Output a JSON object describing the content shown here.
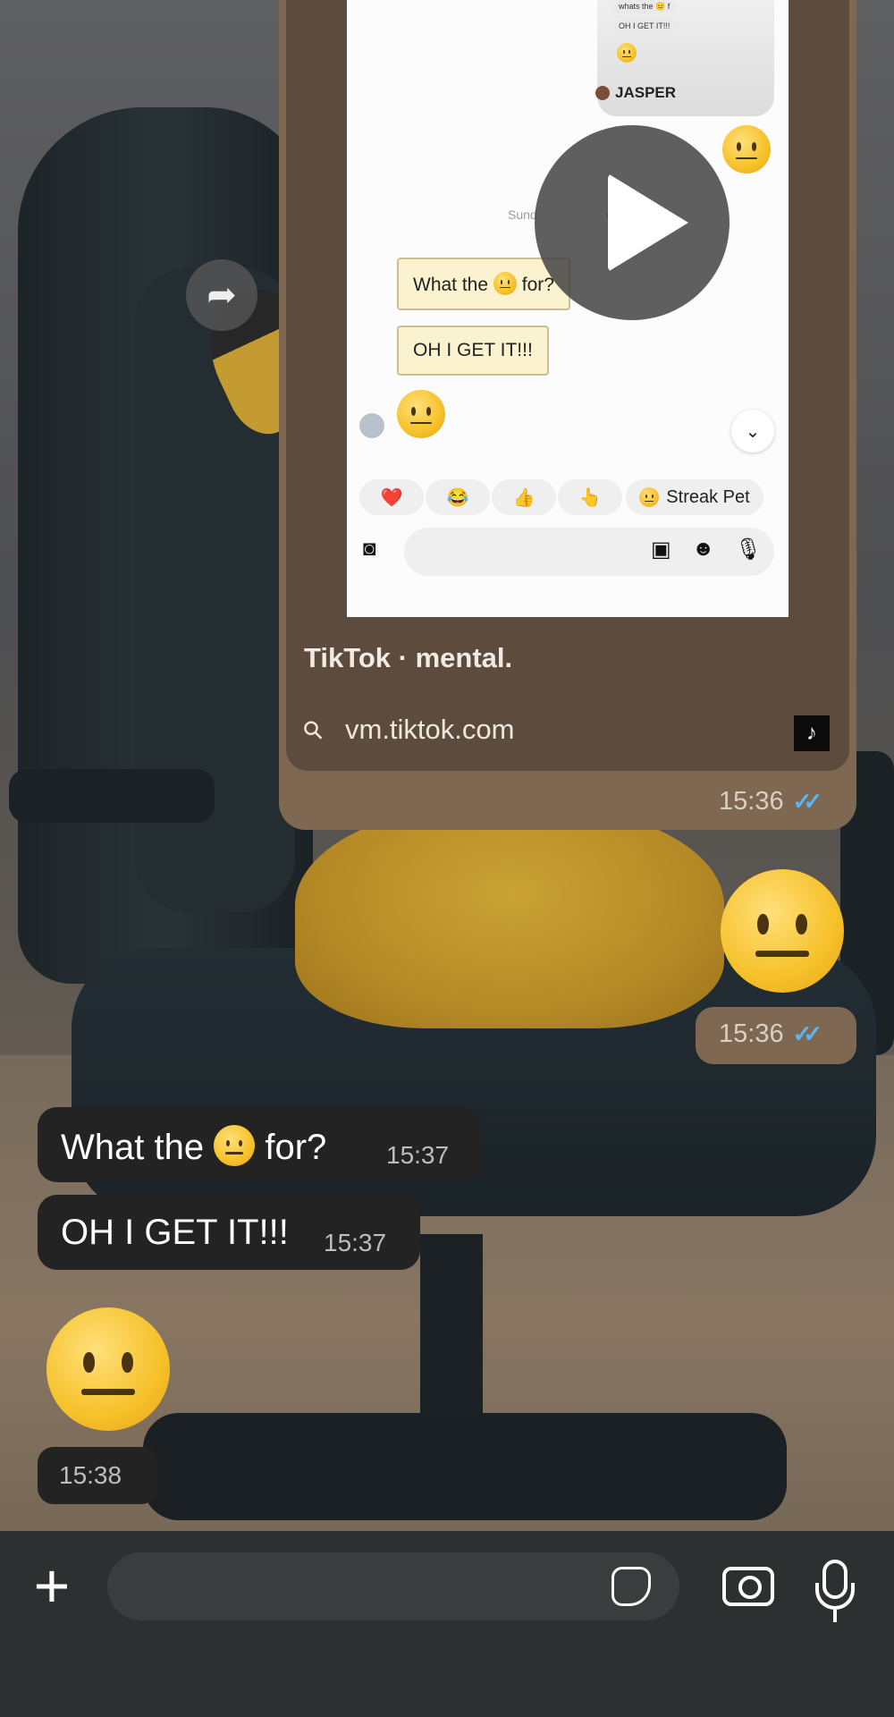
{
  "shared_post": {
    "link_title": "TikTok · mental.",
    "link_url": "vm.tiktok.com",
    "time": "15:36",
    "preview": {
      "mini_text_1": "whats the 😐 f",
      "mini_text_2": "OH I GET IT!!!",
      "sender_name": "JASPER",
      "date_label": "Sund",
      "date_label_tail": "m",
      "sticker_1_before": "What the",
      "sticker_1_after": "for?",
      "sticker_2": "OH I GET IT!!!",
      "quick_reactions": [
        "❤️",
        "😂",
        "👍",
        "👆"
      ],
      "streak_pill": "Streak Pet"
    }
  },
  "outgoing_emoji_message": {
    "emoji": "neutral-face",
    "time": "15:36"
  },
  "incoming_messages": [
    {
      "before": "What the",
      "after": "for?",
      "time": "15:37"
    },
    {
      "text": "OH I GET IT!!!",
      "time": "15:37"
    }
  ],
  "incoming_emoji_message": {
    "emoji": "neutral-face",
    "time": "15:38"
  },
  "colors": {
    "outgoing_bubble": "#7e6851",
    "incoming_bubble": "#232323",
    "read_ticks": "#5cb6f2"
  }
}
